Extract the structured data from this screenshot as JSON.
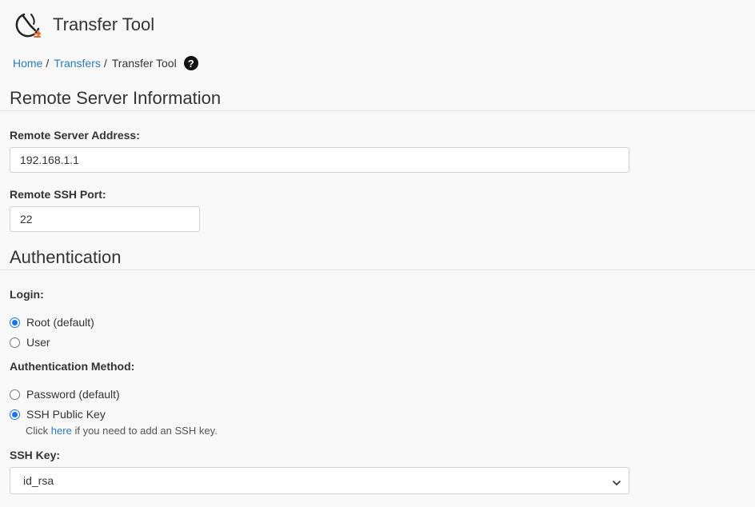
{
  "header": {
    "title": "Transfer Tool",
    "icon": "transfer-tool-icon"
  },
  "breadcrumb": {
    "items": [
      {
        "label": "Home"
      },
      {
        "label": "Transfers"
      }
    ],
    "separator": "/",
    "current": "Transfer Tool",
    "help_icon": "?"
  },
  "remote_server": {
    "heading": "Remote Server Information",
    "address_label": "Remote Server Address:",
    "address_value": "192.168.1.1",
    "port_label": "Remote SSH Port:",
    "port_value": "22"
  },
  "authentication": {
    "heading": "Authentication",
    "login_label": "Login:",
    "login_options": [
      {
        "label": "Root (default)",
        "checked": true
      },
      {
        "label": "User",
        "checked": false
      }
    ],
    "method_label": "Authentication Method:",
    "method_options": [
      {
        "label": "Password (default)",
        "checked": false
      },
      {
        "label": "SSH Public Key",
        "checked": true
      }
    ],
    "hint_prefix": "Click",
    "hint_link": "here",
    "hint_suffix": "if you need to add an SSH key.",
    "ssh_key_label": "SSH Key:",
    "ssh_key_selected": "id_rsa"
  },
  "colors": {
    "link": "#2b7bb9",
    "radio_checked": "#1a73e8",
    "background": "#f8f8f8"
  }
}
